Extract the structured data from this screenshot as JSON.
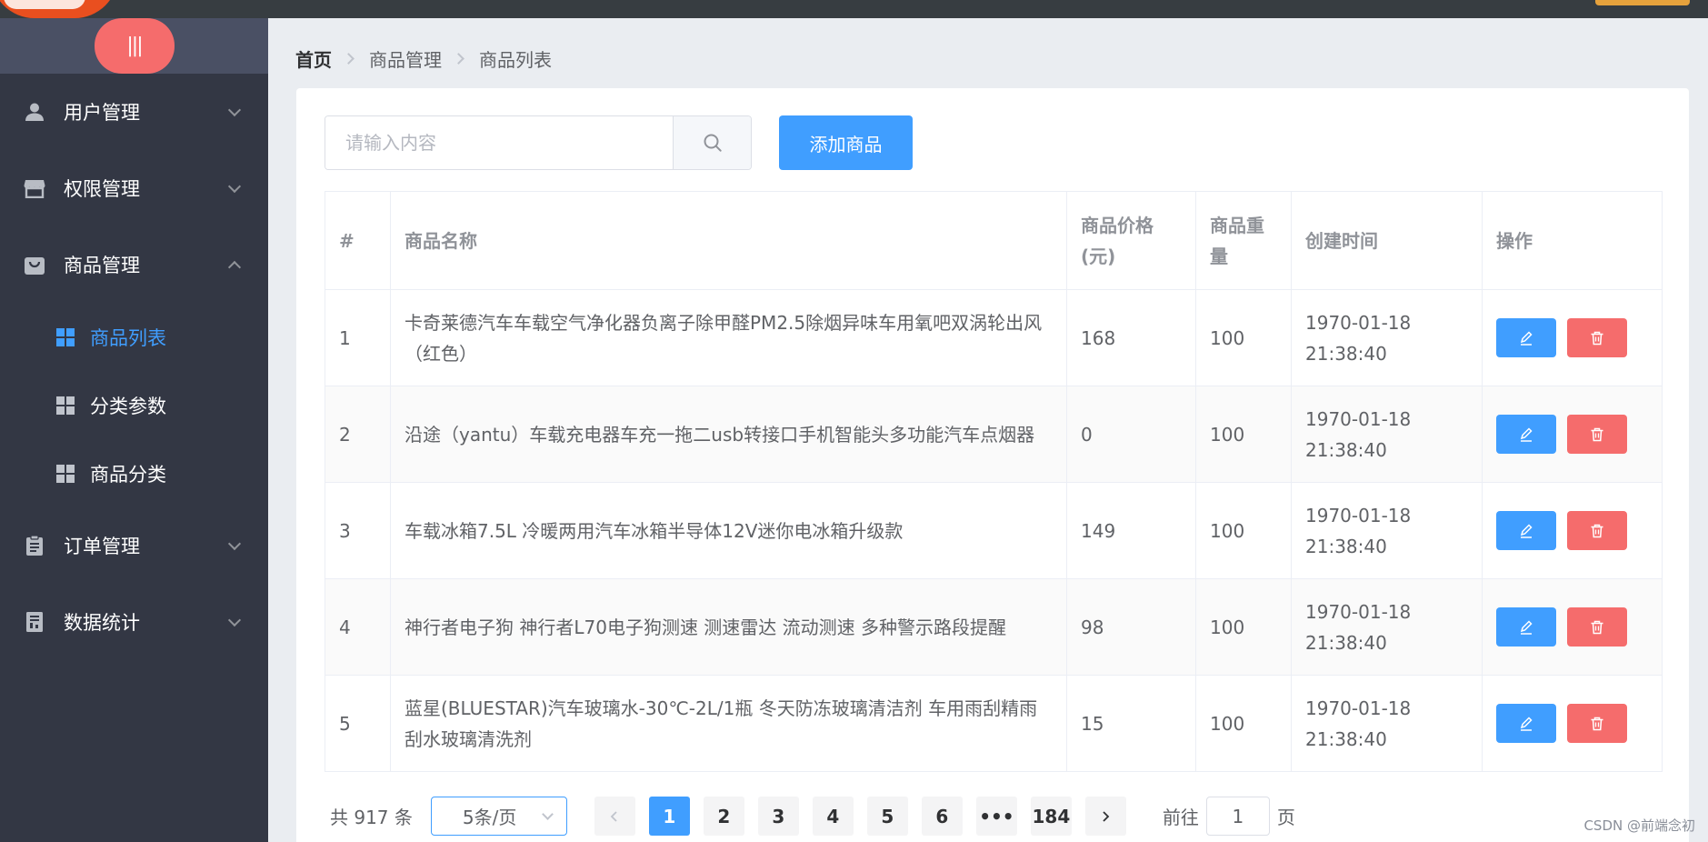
{
  "sidebar": {
    "toggle_label": "|||",
    "menus": [
      {
        "label": "用户管理",
        "icon": "user-icon"
      },
      {
        "label": "权限管理",
        "icon": "shop-icon"
      },
      {
        "label": "商品管理",
        "icon": "bag-icon"
      },
      {
        "label": "订单管理",
        "icon": "clipboard-icon"
      },
      {
        "label": "数据统计",
        "icon": "report-icon"
      }
    ],
    "goods_submenu": [
      {
        "label": "商品列表",
        "active": true
      },
      {
        "label": "分类参数",
        "active": false
      },
      {
        "label": "商品分类",
        "active": false
      }
    ]
  },
  "breadcrumb": {
    "home": "首页",
    "level1": "商品管理",
    "level2": "商品列表"
  },
  "toolbar": {
    "search_placeholder": "请输入内容",
    "add_button": "添加商品"
  },
  "table": {
    "headers": {
      "index": "#",
      "name": "商品名称",
      "price": "商品价格(元)",
      "weight": "商品重量",
      "created": "创建时间",
      "ops": "操作"
    },
    "rows": [
      {
        "index": "1",
        "name": "卡奇莱德汽车车载空气净化器负离子除甲醛PM2.5除烟异味车用氧吧双涡轮出风（红色）",
        "price": "168",
        "weight": "100",
        "created": "1970-01-18 21:38:40"
      },
      {
        "index": "2",
        "name": "沿途（yantu）车载充电器车充一拖二usb转接口手机智能头多功能汽车点烟器",
        "price": "0",
        "weight": "100",
        "created": "1970-01-18 21:38:40"
      },
      {
        "index": "3",
        "name": "车载冰箱7.5L 冷暖两用汽车冰箱半导体12V迷你电冰箱升级款",
        "price": "149",
        "weight": "100",
        "created": "1970-01-18 21:38:40"
      },
      {
        "index": "4",
        "name": "神行者电子狗 神行者L70电子狗测速 测速雷达 流动测速 多种警示路段提醒",
        "price": "98",
        "weight": "100",
        "created": "1970-01-18 21:38:40"
      },
      {
        "index": "5",
        "name": "蓝星(BLUESTAR)汽车玻璃水-30℃-2L/1瓶 冬天防冻玻璃清洁剂 车用雨刮精雨刮水玻璃清洗剂",
        "price": "15",
        "weight": "100",
        "created": "1970-01-18 21:38:40"
      }
    ]
  },
  "pagination": {
    "total": "共 917 条",
    "page_size": "5条/页",
    "pages": [
      "1",
      "2",
      "3",
      "4",
      "5",
      "6",
      "•••",
      "184"
    ],
    "current": "1",
    "goto_prefix": "前往",
    "goto_value": "1",
    "goto_suffix": "页"
  },
  "watermark": "CSDN @前端念初",
  "colors": {
    "primary": "#409eff",
    "danger": "#f56c6c",
    "sidebar_bg": "#333744",
    "toggle": "#f56c6c"
  }
}
